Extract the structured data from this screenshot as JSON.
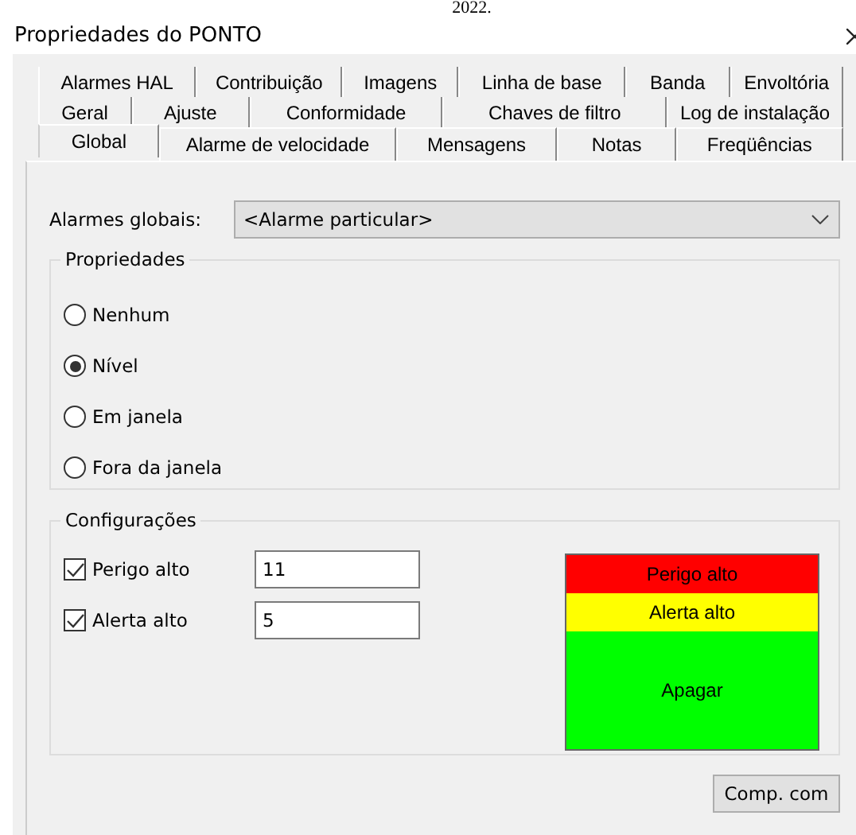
{
  "top_text": "2022.",
  "window": {
    "title": "Propriedades do PONTO"
  },
  "tab_rows": [
    [
      {
        "label": "Alarmes HAL",
        "selected": false
      },
      {
        "label": "Contribuição",
        "selected": false
      },
      {
        "label": "Imagens",
        "selected": false
      },
      {
        "label": "Linha de base",
        "selected": false
      },
      {
        "label": "Banda",
        "selected": false
      },
      {
        "label": "Envoltória",
        "selected": false
      }
    ],
    [
      {
        "label": "Geral",
        "selected": false
      },
      {
        "label": "Ajuste",
        "selected": false
      },
      {
        "label": "Conformidade",
        "selected": false
      },
      {
        "label": "Chaves de filtro",
        "selected": false
      },
      {
        "label": "Log de instalação",
        "selected": false
      }
    ],
    [
      {
        "label": "Global",
        "selected": true
      },
      {
        "label": "Alarme de velocidade",
        "selected": false
      },
      {
        "label": "Mensagens",
        "selected": false
      },
      {
        "label": "Notas",
        "selected": false
      },
      {
        "label": "Freqüências",
        "selected": false
      }
    ]
  ],
  "global_alarms": {
    "label": "Alarmes globais:",
    "value": "<Alarme particular>"
  },
  "properties": {
    "title": "Propriedades",
    "options": [
      {
        "label": "Nenhum",
        "selected": false
      },
      {
        "label": "Nível",
        "selected": true
      },
      {
        "label": "Em janela",
        "selected": false
      },
      {
        "label": "Fora da janela",
        "selected": false
      }
    ]
  },
  "settings": {
    "title": "Configurações",
    "items": [
      {
        "label": "Perigo alto",
        "checked": true,
        "value": "11"
      },
      {
        "label": "Alerta alto",
        "checked": true,
        "value": "5"
      }
    ],
    "zones": [
      {
        "label": "Perigo alto",
        "color": "#ff0000"
      },
      {
        "label": "Alerta alto",
        "color": "#ffff00"
      },
      {
        "label": "Apagar",
        "color": "#00ff00"
      }
    ]
  },
  "buttons": [
    "Comp. com"
  ]
}
